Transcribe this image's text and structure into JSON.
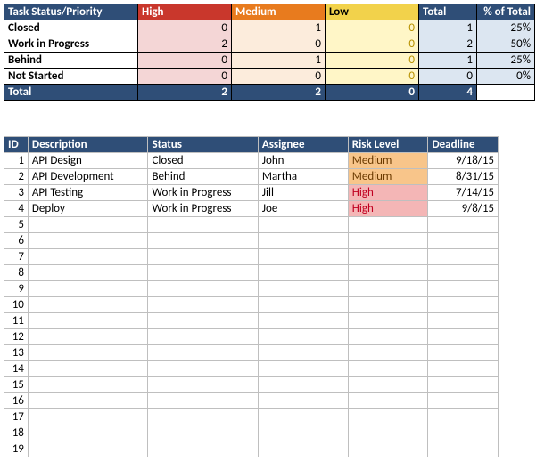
{
  "summary": {
    "headers": {
      "status": "Task Status/Priority",
      "high": "High",
      "medium": "Medium",
      "low": "Low",
      "total": "Total",
      "pct": "% of Total"
    },
    "rows": [
      {
        "label": "Closed",
        "high": "0",
        "medium": "1",
        "low": "0",
        "total": "1",
        "pct": "25%"
      },
      {
        "label": "Work in Progress",
        "high": "2",
        "medium": "0",
        "low": "0",
        "total": "2",
        "pct": "50%"
      },
      {
        "label": "Behind",
        "high": "0",
        "medium": "1",
        "low": "0",
        "total": "1",
        "pct": "25%"
      },
      {
        "label": "Not Started",
        "high": "0",
        "medium": "0",
        "low": "0",
        "total": "0",
        "pct": "0%"
      }
    ],
    "totals": {
      "label": "Total",
      "high": "2",
      "medium": "2",
      "low": "0",
      "total": "4",
      "pct": ""
    }
  },
  "tasks": {
    "headers": {
      "id": "ID",
      "desc": "Description",
      "status": "Status",
      "assignee": "Assignee",
      "risk": "Risk Level",
      "deadline": "Deadline"
    },
    "rows": [
      {
        "id": "1",
        "desc": "API Design",
        "status": "Closed",
        "assignee": "John",
        "risk": "Medium",
        "risk_class": "risk-med",
        "deadline": "9/18/15"
      },
      {
        "id": "2",
        "desc": "API Development",
        "status": "Behind",
        "assignee": "Martha",
        "risk": "Medium",
        "risk_class": "risk-med",
        "deadline": "8/31/15"
      },
      {
        "id": "3",
        "desc": "API Testing",
        "status": "Work in Progress",
        "assignee": "Jill",
        "risk": "High",
        "risk_class": "risk-high",
        "deadline": "7/14/15"
      },
      {
        "id": "4",
        "desc": "Deploy",
        "status": "Work in Progress",
        "assignee": "Joe",
        "risk": "High",
        "risk_class": "risk-high",
        "deadline": "9/8/15"
      }
    ],
    "empty_start": 5,
    "empty_end": 19
  }
}
